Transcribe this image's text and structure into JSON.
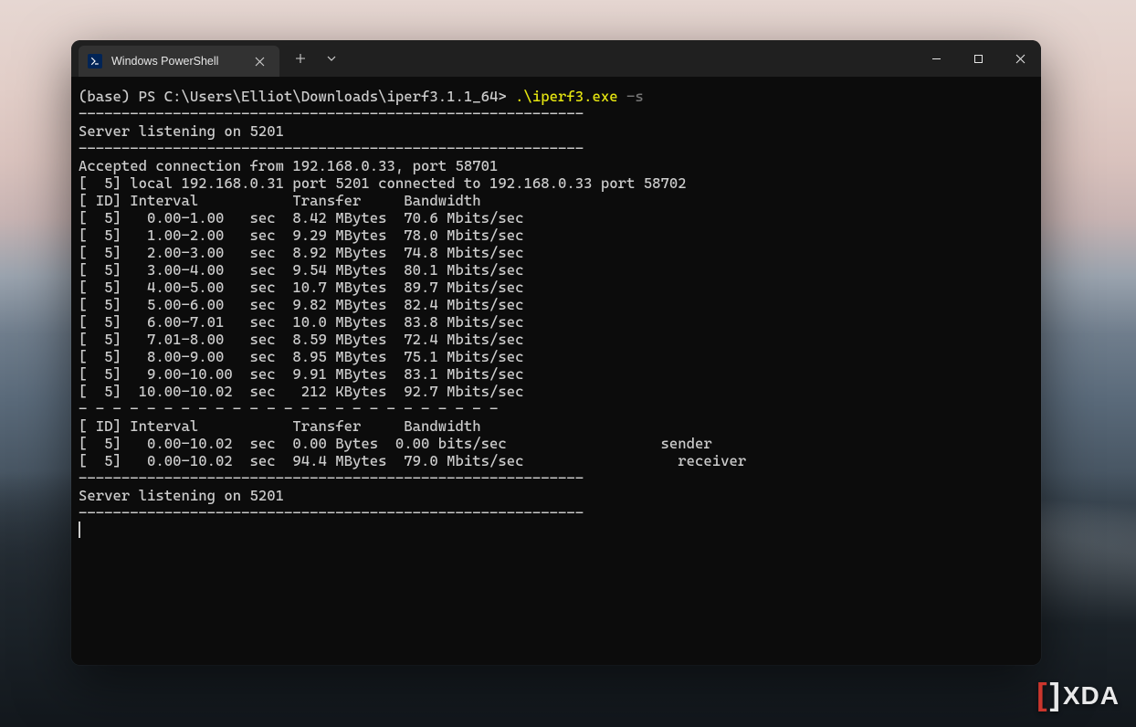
{
  "tab": {
    "title": "Windows PowerShell"
  },
  "prompt": {
    "base": "(base) PS C:\\Users\\Elliot\\Downloads\\iperf3.1.1_64> ",
    "cmd": ".\\iperf3.exe",
    "arg": " -s"
  },
  "divider": "-----------------------------------------------------------",
  "dashline": "- - - - - - - - - - - - - - - - - - - - - - - - -",
  "listening": "Server listening on 5201",
  "accepted": "Accepted connection from 192.168.0.33, port 58701",
  "local": "[  5] local 192.168.0.31 port 5201 connected to 192.168.0.33 port 58702",
  "header": "[ ID] Interval           Transfer     Bandwidth",
  "rows": [
    "[  5]   0.00-1.00   sec  8.42 MBytes  70.6 Mbits/sec",
    "[  5]   1.00-2.00   sec  9.29 MBytes  78.0 Mbits/sec",
    "[  5]   2.00-3.00   sec  8.92 MBytes  74.8 Mbits/sec",
    "[  5]   3.00-4.00   sec  9.54 MBytes  80.1 Mbits/sec",
    "[  5]   4.00-5.00   sec  10.7 MBytes  89.7 Mbits/sec",
    "[  5]   5.00-6.00   sec  9.82 MBytes  82.4 Mbits/sec",
    "[  5]   6.00-7.01   sec  10.0 MBytes  83.8 Mbits/sec",
    "[  5]   7.01-8.00   sec  8.59 MBytes  72.4 Mbits/sec",
    "[  5]   8.00-9.00   sec  8.95 MBytes  75.1 Mbits/sec",
    "[  5]   9.00-10.00  sec  9.91 MBytes  83.1 Mbits/sec",
    "[  5]  10.00-10.02  sec   212 KBytes  92.7 Mbits/sec"
  ],
  "summary": [
    "[  5]   0.00-10.02  sec  0.00 Bytes  0.00 bits/sec                  sender",
    "[  5]   0.00-10.02  sec  94.4 MBytes  79.0 Mbits/sec                  receiver"
  ],
  "watermark": "XDA"
}
